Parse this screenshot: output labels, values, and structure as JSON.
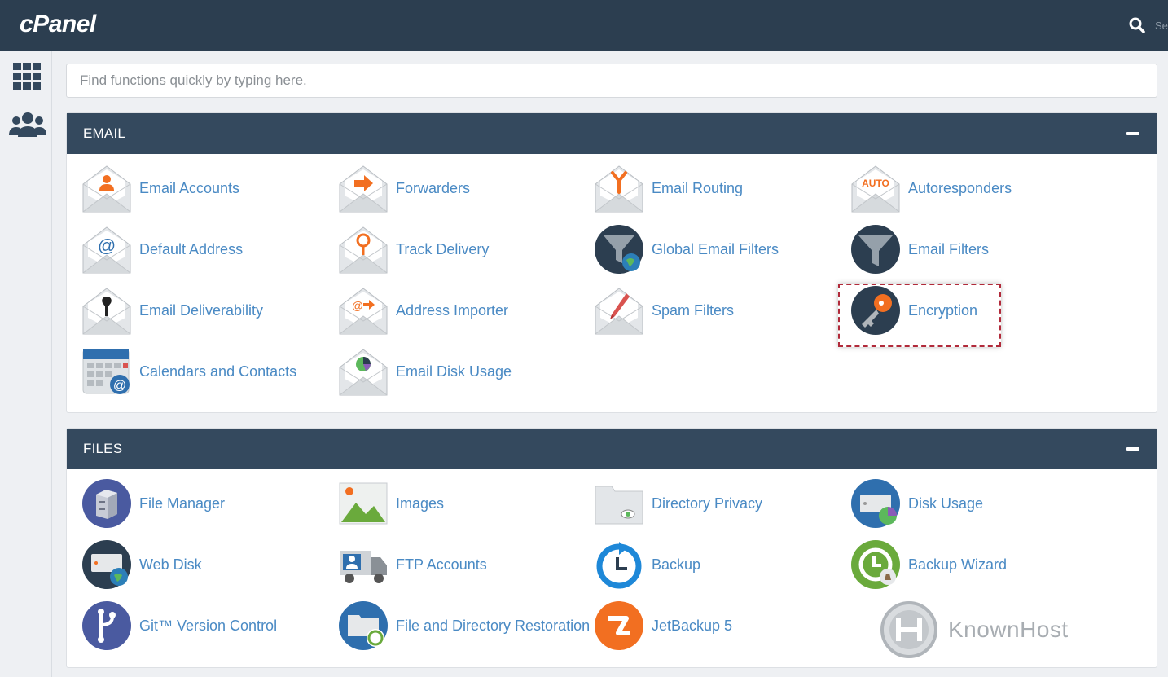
{
  "app": {
    "logo": "cPanel",
    "search_hint": "Se"
  },
  "search": {
    "placeholder": "Find functions quickly by typing here."
  },
  "sections": {
    "email": {
      "title": "EMAIL",
      "items": [
        "Email Accounts",
        "Forwarders",
        "Email Routing",
        "Autoresponders",
        "Default Address",
        "Track Delivery",
        "Global Email Filters",
        "Email Filters",
        "Email Deliverability",
        "Address Importer",
        "Spam Filters",
        "Encryption",
        "Calendars and Contacts",
        "Email Disk Usage"
      ]
    },
    "files": {
      "title": "FILES",
      "items": [
        "File Manager",
        "Images",
        "Directory Privacy",
        "Disk Usage",
        "Web Disk",
        "FTP Accounts",
        "Backup",
        "Backup Wizard",
        "Git™ Version Control",
        "File and Directory Restoration",
        "JetBackup 5"
      ]
    }
  },
  "icons": {
    "envelope_fill": "#e3e6e9",
    "accent_orange": "#f26f21",
    "dark_navy": "#2c3e50",
    "link_blue": "#4a8ac4"
  },
  "watermark": {
    "text": "KnownHost"
  }
}
